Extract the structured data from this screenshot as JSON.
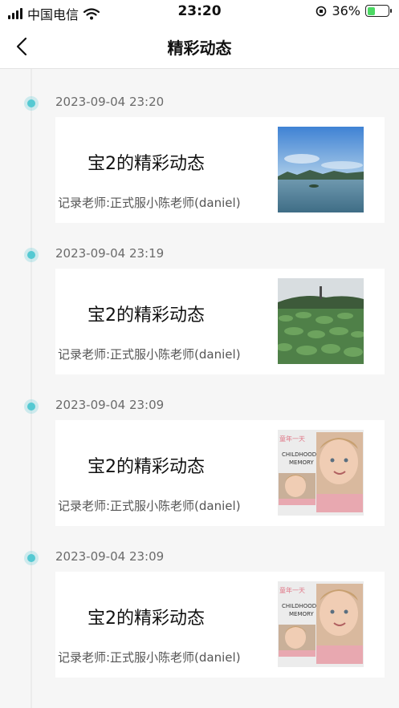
{
  "status_bar": {
    "carrier": "中国电信",
    "time": "23:20",
    "battery_percent": "36%",
    "battery_level": 0.36
  },
  "nav": {
    "back_icon": "chevron-left-icon",
    "title": "精彩动态"
  },
  "colors": {
    "accent": "#55c9d2",
    "background": "#f6f6f6",
    "card": "#ffffff"
  },
  "entries": [
    {
      "timestamp": "2023-09-04 23:20",
      "title": "宝2的精彩动态",
      "teacher": "记录老师:正式服小陈老师(daniel)",
      "thumbnail": "lake-landscape-photo"
    },
    {
      "timestamp": "2023-09-04 23:19",
      "title": "宝2的精彩动态",
      "teacher": "记录老师:正式服小陈老师(daniel)",
      "thumbnail": "lotus-field-photo"
    },
    {
      "timestamp": "2023-09-04 23:09",
      "title": "宝2的精彩动态",
      "teacher": "记录老师:正式服小陈老师(daniel)",
      "thumbnail": "childhood-memory-collage"
    },
    {
      "timestamp": "2023-09-04 23:09",
      "title": "宝2的精彩动态",
      "teacher": "记录老师:正式服小陈老师(daniel)",
      "thumbnail": "childhood-memory-collage"
    }
  ],
  "collage_text": {
    "line1": "童年一天",
    "line2": "CHILDHOOD",
    "line3": "MEMORY"
  }
}
